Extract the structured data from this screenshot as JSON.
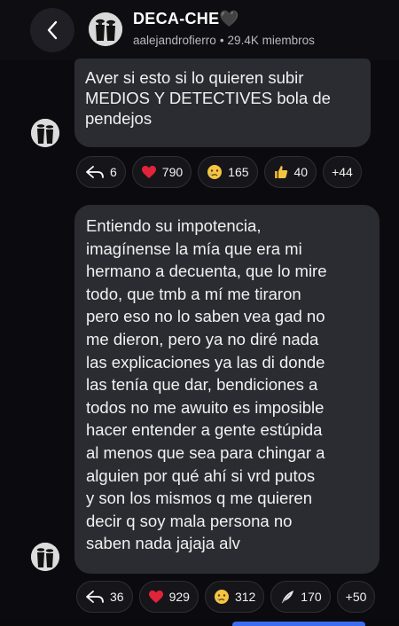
{
  "header": {
    "title": "DECA-CHE🖤",
    "username": "aalejandrofierro",
    "separator": "•",
    "members": "29.4K miembros"
  },
  "messages": [
    {
      "lines": [
        "Aver si esto si lo quieren subir",
        "MEDIOS Y DETECTIVES bola de",
        "pendejos"
      ],
      "reactions": [
        {
          "icon": "reply-icon",
          "count": "6"
        },
        {
          "icon": "heart-icon",
          "count": "790"
        },
        {
          "icon": "crying-face-icon",
          "count": "165"
        },
        {
          "icon": "thumbs-up-icon",
          "count": "40"
        },
        {
          "icon": "more",
          "count": "+44"
        }
      ]
    },
    {
      "lines": [
        "Entiendo su impotencia,",
        "imagínense la mía que era mi",
        "hermano a decuenta, que lo mire",
        "todo, que tmb a mí me tiraron",
        "pero eso no lo saben vea gad no",
        "me dieron, pero ya no diré nada",
        "las explicaciones ya las di donde",
        "las tenía que dar, bendiciones a",
        "todos no me awuito es imposible",
        "hacer entender a gente estúpida",
        "al menos que sea para chingar a",
        "alguien por qué ahí si vrd putos",
        "y son los mismos q me quieren",
        "decir q soy mala persona no",
        "saben nada jajaja alv"
      ],
      "reactions": [
        {
          "icon": "reply-icon",
          "count": "36"
        },
        {
          "icon": "heart-icon",
          "count": "929"
        },
        {
          "icon": "crying-face-icon",
          "count": "312"
        },
        {
          "icon": "feather-icon",
          "count": "170"
        },
        {
          "icon": "more",
          "count": "+50"
        }
      ]
    }
  ],
  "colors": {
    "background": "#0b0b0f",
    "bubble": "#2b2c31",
    "heart": "#e0243a",
    "emoji_yellow": "#f5c542",
    "accent": "#3b6df0"
  }
}
